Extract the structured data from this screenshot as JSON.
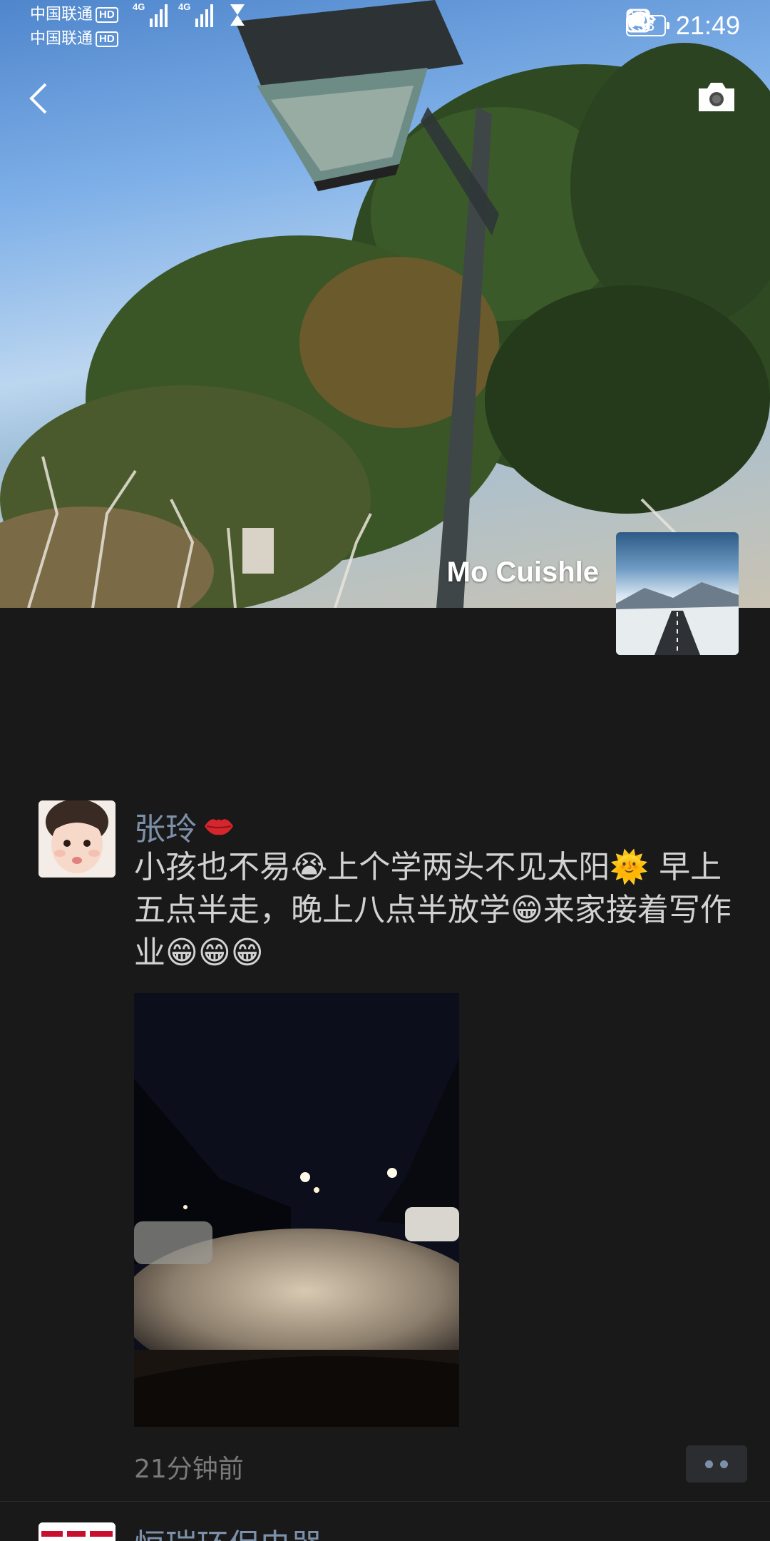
{
  "status_bar": {
    "carrier_1": "中国联通",
    "carrier_2": "中国联通",
    "hd_badge": "HD",
    "network_type": "4G",
    "battery_level": "53",
    "time": "21:49"
  },
  "header": {
    "owner_name": "Mo Cuishle"
  },
  "post": {
    "author": "张玲",
    "text": "小孩也不易😭上个学两头不见太阳🌞 早上五点半走，晚上八点半放学😁来家接着写作业😁😁😁",
    "timestamp": "21分钟前"
  },
  "next_post": {
    "author": "恒瑞环保电器"
  },
  "colors": {
    "background": "#191919",
    "name_link": "#7d90a9",
    "body_text": "#d2d2d2",
    "meta_text": "#7a7a7a"
  }
}
